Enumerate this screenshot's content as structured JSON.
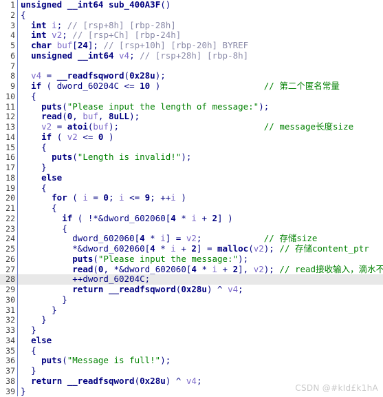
{
  "editor": {
    "name": "ida-pseudocode-view",
    "function_signature": "unsigned __int64 sub_400A3F()",
    "highlighted_line": 28,
    "colors": {
      "background": "#ffffff",
      "gutter_text": "#404040",
      "gutter_border": "#6a7fc9",
      "keyword": "#000080",
      "local_variable": "#7b68c8",
      "string": "#008000",
      "auto_comment": "#8a8aa8",
      "user_comment": "#008000",
      "highlight_row": "#e8e8e8",
      "watermark": "#c9c9c9"
    }
  },
  "lines": [
    {
      "n": "1",
      "indent": 0,
      "code": "unsigned __int64 sub_400A3F()",
      "comment": "",
      "comment_kind": ""
    },
    {
      "n": "2",
      "indent": 0,
      "code": "{",
      "comment": "",
      "comment_kind": ""
    },
    {
      "n": "3",
      "indent": 1,
      "code": "int i;",
      "comment": "// [rsp+8h] [rbp-28h]",
      "comment_kind": "auto"
    },
    {
      "n": "4",
      "indent": 1,
      "code": "int v2;",
      "comment": "// [rsp+Ch] [rbp-24h]",
      "comment_kind": "auto"
    },
    {
      "n": "5",
      "indent": 1,
      "code": "char buf[24];",
      "comment": "// [rsp+10h] [rbp-20h] BYREF",
      "comment_kind": "auto"
    },
    {
      "n": "6",
      "indent": 1,
      "code": "unsigned __int64 v4;",
      "comment": "// [rsp+28h] [rbp-8h]",
      "comment_kind": "auto"
    },
    {
      "n": "7",
      "indent": 0,
      "code": "",
      "comment": "",
      "comment_kind": ""
    },
    {
      "n": "8",
      "indent": 1,
      "code": "v4 = __readfsqword(0x28u);",
      "comment": "",
      "comment_kind": ""
    },
    {
      "n": "9",
      "indent": 1,
      "code": "if ( dword_60204C <= 10 )",
      "comment": "// 第二个匿名常量",
      "comment_kind": "user"
    },
    {
      "n": "10",
      "indent": 1,
      "code": "{",
      "comment": "",
      "comment_kind": ""
    },
    {
      "n": "11",
      "indent": 2,
      "code": "puts(\"Please input the length of message:\");",
      "comment": "",
      "comment_kind": ""
    },
    {
      "n": "12",
      "indent": 2,
      "code": "read(0, buf, 8uLL);",
      "comment": "",
      "comment_kind": ""
    },
    {
      "n": "13",
      "indent": 2,
      "code": "v2 = atoi(buf);",
      "comment": "// message长度size",
      "comment_kind": "user"
    },
    {
      "n": "14",
      "indent": 2,
      "code": "if ( v2 <= 0 )",
      "comment": "",
      "comment_kind": ""
    },
    {
      "n": "15",
      "indent": 2,
      "code": "{",
      "comment": "",
      "comment_kind": ""
    },
    {
      "n": "16",
      "indent": 3,
      "code": "puts(\"Length is invalid!\");",
      "comment": "",
      "comment_kind": ""
    },
    {
      "n": "17",
      "indent": 2,
      "code": "}",
      "comment": "",
      "comment_kind": ""
    },
    {
      "n": "18",
      "indent": 2,
      "code": "else",
      "comment": "",
      "comment_kind": ""
    },
    {
      "n": "19",
      "indent": 2,
      "code": "{",
      "comment": "",
      "comment_kind": ""
    },
    {
      "n": "20",
      "indent": 3,
      "code": "for ( i = 0; i <= 9; ++i )",
      "comment": "",
      "comment_kind": ""
    },
    {
      "n": "21",
      "indent": 3,
      "code": "{",
      "comment": "",
      "comment_kind": ""
    },
    {
      "n": "22",
      "indent": 4,
      "code": "if ( !*&dword_602060[4 * i + 2] )",
      "comment": "",
      "comment_kind": ""
    },
    {
      "n": "23",
      "indent": 4,
      "code": "{",
      "comment": "",
      "comment_kind": ""
    },
    {
      "n": "24",
      "indent": 5,
      "code": "dword_602060[4 * i] = v2;",
      "comment": "// 存储size",
      "comment_kind": "user"
    },
    {
      "n": "25",
      "indent": 5,
      "code": "*&dword_602060[4 * i + 2] = malloc(v2);",
      "comment": "// 存储content_ptr",
      "comment_kind": "user"
    },
    {
      "n": "26",
      "indent": 5,
      "code": "puts(\"Please input the message:\");",
      "comment": "",
      "comment_kind": ""
    },
    {
      "n": "27",
      "indent": 5,
      "code": "read(0, *&dword_602060[4 * i + 2], v2);",
      "comment": "// read接收输入，滴水不漏",
      "comment_kind": "user"
    },
    {
      "n": "28",
      "indent": 5,
      "code": "++dword_60204C;",
      "comment": "",
      "comment_kind": ""
    },
    {
      "n": "29",
      "indent": 5,
      "code": "return __readfsqword(0x28u) ^ v4;",
      "comment": "",
      "comment_kind": ""
    },
    {
      "n": "30",
      "indent": 4,
      "code": "}",
      "comment": "",
      "comment_kind": ""
    },
    {
      "n": "31",
      "indent": 3,
      "code": "}",
      "comment": "",
      "comment_kind": ""
    },
    {
      "n": "32",
      "indent": 2,
      "code": "}",
      "comment": "",
      "comment_kind": ""
    },
    {
      "n": "33",
      "indent": 1,
      "code": "}",
      "comment": "",
      "comment_kind": ""
    },
    {
      "n": "34",
      "indent": 1,
      "code": "else",
      "comment": "",
      "comment_kind": ""
    },
    {
      "n": "35",
      "indent": 1,
      "code": "{",
      "comment": "",
      "comment_kind": ""
    },
    {
      "n": "36",
      "indent": 2,
      "code": "puts(\"Message is full!\");",
      "comment": "",
      "comment_kind": ""
    },
    {
      "n": "37",
      "indent": 1,
      "code": "}",
      "comment": "",
      "comment_kind": ""
    },
    {
      "n": "38",
      "indent": 1,
      "code": "return __readfsqword(0x28u) ^ v4;",
      "comment": "",
      "comment_kind": ""
    },
    {
      "n": "39",
      "indent": 0,
      "code": "}",
      "comment": "",
      "comment_kind": ""
    }
  ],
  "watermark": {
    "text": "CSDN @#kId£k1hA"
  }
}
